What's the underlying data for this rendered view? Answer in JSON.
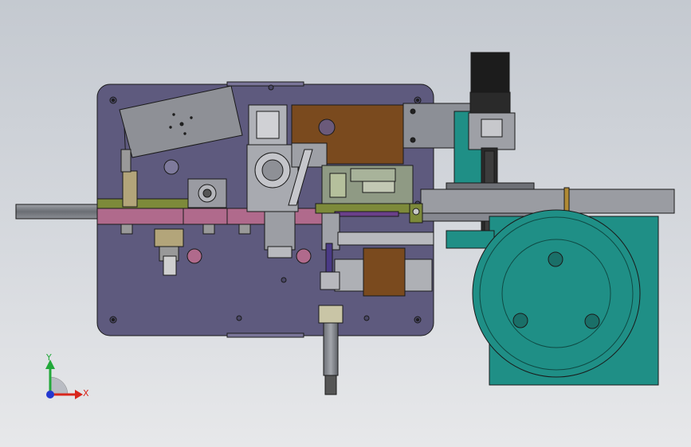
{
  "viewport": {
    "background_top": "#c4c9d0",
    "background_bottom": "#e7e8ea"
  },
  "model": {
    "plate_color": "#5e5a7e",
    "edge_color": "#1a1a1a",
    "part_colors": {
      "steel": "#8c8f96",
      "brass": "#7a4a1e",
      "teal": "#1f8f86",
      "pink": "#b06a8c",
      "olive": "#7d8a3a",
      "motor": "#1c1c1c"
    }
  },
  "triad": {
    "x_label": "X",
    "y_label": "Y",
    "x_color": "#d8261c",
    "y_color": "#22a83a",
    "z_color": "#2438d0"
  }
}
